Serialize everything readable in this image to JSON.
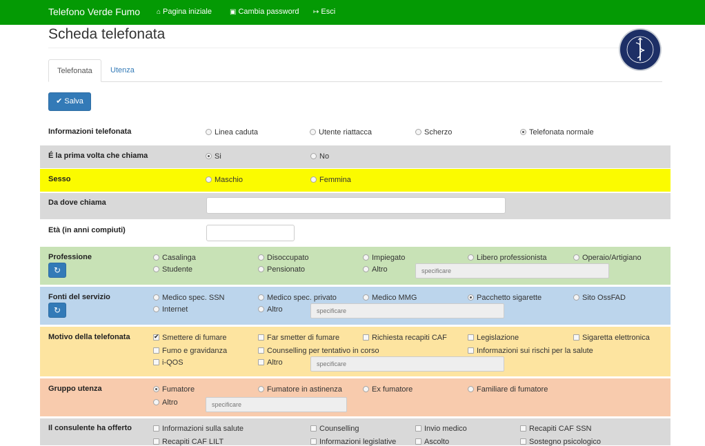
{
  "navbar": {
    "brand": "Telefono Verde Fumo",
    "links": [
      {
        "icon": "home-icon",
        "glyph": "⌂",
        "label": "Pagina iniziale"
      },
      {
        "icon": "lock-icon",
        "glyph": "▣",
        "label": "Cambia password"
      },
      {
        "icon": "sign-out-icon",
        "glyph": "↦",
        "label": "Esci"
      }
    ]
  },
  "page": {
    "title": "Scheda telefonata"
  },
  "tabs": [
    {
      "label": "Telefonata",
      "active": true
    },
    {
      "label": "Utenza",
      "active": false
    }
  ],
  "toolbar": {
    "save_label": "Salva",
    "save_icon": "check-icon"
  },
  "colors": {
    "navbar": "#049a04",
    "primary": "#337ab7",
    "gray_row": "#d9d9d9",
    "yellow_row": "#fbfb00",
    "green_row": "#c8e2b6",
    "blue_row": "#bcd5ec",
    "orange_row": "#fde4a0",
    "salmon_row": "#f8cbad"
  },
  "form": {
    "informazioni": {
      "label": "Informazioni telefonata",
      "options": [
        "Linea caduta",
        "Utente riattacca",
        "Scherzo",
        "Telefonata normale"
      ],
      "selected": "Telefonata normale"
    },
    "prima_volta": {
      "label": "É la prima volta che chiama",
      "options": [
        "Si",
        "No"
      ],
      "selected": "Si"
    },
    "sesso": {
      "label": "Sesso",
      "options": [
        "Maschio",
        "Femmina"
      ],
      "selected": ""
    },
    "da_dove": {
      "label": "Da dove chiama",
      "value": ""
    },
    "eta": {
      "label": "Età (in anni compiuti)",
      "value": ""
    },
    "professione": {
      "label": "Professione",
      "options": [
        "Casalinga",
        "Disoccupato",
        "Impiegato",
        "Libero professionista",
        "Operaio/Artigiano",
        "Studente",
        "Pensionato",
        "Altro"
      ],
      "specify_placeholder": "specificare"
    },
    "fonti": {
      "label": "Fonti del servizio",
      "options": [
        "Medico spec. SSN",
        "Medico spec. privato",
        "Medico MMG",
        "Pacchetto sigarette",
        "Sito OssFAD",
        "Internet",
        "Altro"
      ],
      "selected": "Pacchetto sigarette",
      "specify_placeholder": "specificare"
    },
    "motivo": {
      "label": "Motivo della telefonata",
      "options": [
        "Smettere di fumare",
        "Far smetter di fumare",
        "Richiesta recapiti CAF",
        "Legislazione",
        "Sigaretta elettronica",
        "Fumo e gravidanza",
        "Counselling per tentativo in corso",
        "Informazioni sui rischi per la salute",
        "i-QOS",
        "Altro"
      ],
      "checked": [
        "Smettere di fumare"
      ],
      "specify_placeholder": "specificare"
    },
    "gruppo": {
      "label": "Gruppo utenza",
      "options": [
        "Fumatore",
        "Fumatore in astinenza",
        "Ex fumatore",
        "Familiare di fumatore",
        "Altro"
      ],
      "selected": "Fumatore",
      "specify_placeholder": "specificare"
    },
    "consulente": {
      "label": "Il consulente ha offerto",
      "options": [
        "Informazioni sulla salute",
        "Counselling",
        "Invio medico",
        "Recapiti CAF SSN",
        "Recapiti CAF LILT",
        "Informazioni legislative",
        "Ascolto",
        "Sostegno psicologico"
      ]
    }
  }
}
